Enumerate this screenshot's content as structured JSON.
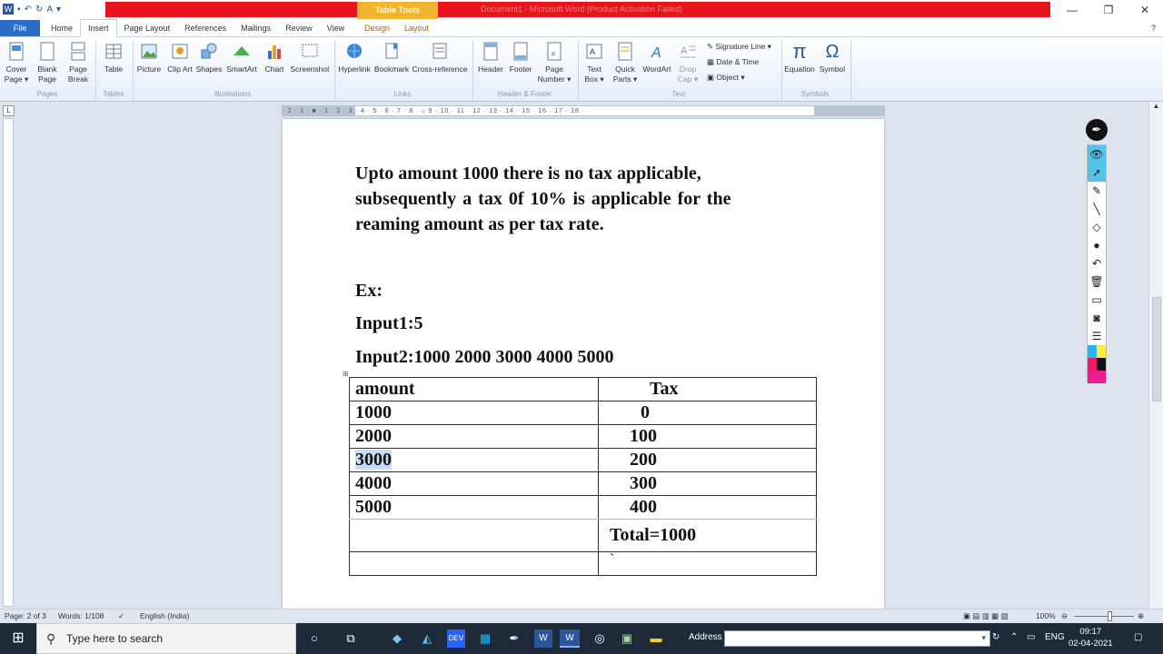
{
  "window": {
    "title": "Document1 - Microsoft Word (Product Activation Failed)",
    "context_tab": "Table Tools"
  },
  "tabs": [
    "File",
    "Home",
    "Insert",
    "Page Layout",
    "References",
    "Mailings",
    "Review",
    "View",
    "Design",
    "Layout"
  ],
  "ribbon": {
    "pages": {
      "cover_page": "Cover Page ▾",
      "blank_page": "Blank Page",
      "page_break": "Page Break",
      "group": "Pages"
    },
    "tables": {
      "table": "Table",
      "group": "Tables"
    },
    "illustrations": {
      "picture": "Picture",
      "clip_art": "Clip Art",
      "shapes": "Shapes",
      "smartart": "SmartArt",
      "chart": "Chart",
      "screenshot": "Screenshot",
      "group": "Illustrations"
    },
    "links": {
      "hyperlink": "Hyperlink",
      "bookmark": "Bookmark",
      "cross_reference": "Cross-reference",
      "group": "Links"
    },
    "header_footer": {
      "header": "Header",
      "footer": "Footer",
      "page_number": "Page Number ▾",
      "group": "Header & Footer"
    },
    "text": {
      "text_box": "Text Box ▾",
      "quick_parts": "Quick Parts ▾",
      "wordart": "WordArt",
      "drop_cap": "Drop Cap ▾",
      "signature_line": "Signature Line ▾",
      "date_time": "Date & Time",
      "object": "Object ▾",
      "group": "Text"
    },
    "symbols": {
      "equation": "Equation",
      "symbol": "Symbol",
      "group": "Symbols"
    }
  },
  "ruler": {
    "horizontal": "· 2 · 1 · ■ · 1 · 2 · 3 · 4 · 5 · 6 · 7 · 8 · ⌂ 9 · 10 · 11 · 12 · 13 · 14 · 15 · 16 · 17 · 18 ·"
  },
  "document": {
    "para1_line1": "Upto amount 1000 there is no tax applicable,",
    "para1_line2": "subsequently a tax 0f 10% is applicable for the",
    "para1_line3": "reaming amount as per tax rate.",
    "ex": "Ex:",
    "input1": "Input1:5",
    "input2": "Input2:1000 2000 3000 4000 5000",
    "table": {
      "headers": [
        "amount",
        "Tax"
      ],
      "rows": [
        [
          "1000",
          "0"
        ],
        [
          "2000",
          "100"
        ],
        [
          "3000",
          "200"
        ],
        [
          "4000",
          "300"
        ],
        [
          "5000",
          "400"
        ]
      ],
      "total": "Total=1000",
      "last_cell": "`"
    }
  },
  "status": {
    "page": "Page: 2 of 3",
    "words": "Words: 1/108",
    "language": "English (India)",
    "zoom": "100%"
  },
  "taskbar": {
    "search_placeholder": "Type here to search",
    "address_label": "Address",
    "language": "ENG",
    "time": "09:17",
    "date": "02-04-2021"
  }
}
